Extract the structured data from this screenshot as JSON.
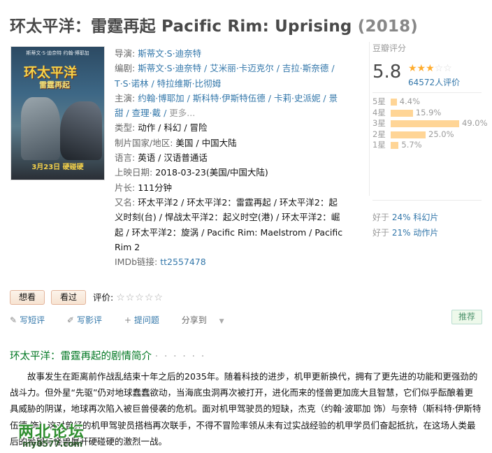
{
  "title": {
    "main": "环太平洋：雷霆再起 Pacific Rim: Uprising",
    "year": "(2018)"
  },
  "poster": {
    "top_text": "斯蒂文·S·迪奈特  约翰·博耶加",
    "title_cn": "环太平洋",
    "subtitle_cn": "雷霆再起",
    "date_text": "3月23日 硬碰硬"
  },
  "info": {
    "director_label": "导演:",
    "director": "斯蒂文·S·迪奈特",
    "writer_label": "编剧:",
    "writer_line1": "斯蒂文·S·迪奈特 / 艾米丽·卡迈克尔 / 吉拉·斯奈德 /",
    "writer_line2": "T·S·诺林 / 特拉维斯·比彻姆",
    "cast_label": "主演:",
    "cast_line1": "约翰·博耶加 / 斯科特·伊斯特伍德 / 卡莉·史派妮 / 景",
    "cast_line2": "甜 / 查理·戴 / ",
    "cast_more": "更多...",
    "genre_label": "类型:",
    "genre": "动作 / 科幻 / 冒险",
    "country_label": "制片国家/地区:",
    "country": "美国 / 中国大陆",
    "language_label": "语言:",
    "language": "英语 / 汉语普通话",
    "release_label": "上映日期:",
    "release": "2018-03-23(美国/中国大陆)",
    "runtime_label": "片长:",
    "runtime": "111分钟",
    "aka_label": "又名:",
    "aka_line1": "环太平洋2 / 环太平洋2：雷霆再起 / 环太平洋2：起",
    "aka_line2": "义时刻(台) / 悍战太平洋2：起义时空(港) / 环太平洋2：崛",
    "aka_line3": "起 / 环太平洋2：旋涡 / Pacific Rim: Maelstrom / Pacific",
    "aka_line4": "Rim 2",
    "imdb_label": "IMDb链接:",
    "imdb": "tt2557478"
  },
  "rating": {
    "header": "豆瓣评分",
    "score": "5.8",
    "stars": "★★★",
    "stars_off": "☆☆",
    "count": "64572人评价",
    "distribution": [
      {
        "label": "5星",
        "pct": "4.4%",
        "value": 4.4
      },
      {
        "label": "4星",
        "pct": "15.9%",
        "value": 15.9
      },
      {
        "label": "3星",
        "pct": "49.0%",
        "value": 49.0
      },
      {
        "label": "2星",
        "pct": "25.0%",
        "value": 25.0
      },
      {
        "label": "1星",
        "pct": "5.7%",
        "value": 5.7
      }
    ],
    "better_than": [
      {
        "prefix": "好于 ",
        "pct": "24%",
        "genre": "科幻片"
      },
      {
        "prefix": "好于 ",
        "pct": "21%",
        "genre": "动作片"
      }
    ]
  },
  "actions": {
    "want": "想看",
    "seen": "看过",
    "eval_label": "评价:",
    "eval_stars": "☆☆☆☆☆",
    "short_review": "写短评",
    "review": "写影评",
    "ask": "提问题",
    "share": "分享到",
    "recommend": "推荐"
  },
  "summary": {
    "heading": "环太平洋：雷霆再起的剧情简介",
    "heading_dots": "· · · · · ·",
    "text": "故事发生在距离前作战乱结束十年之后的2035年。随着科技的进步，机甲更新换代，拥有了更先进的功能和更强劲的战斗力。但外星“先驱”仍对地球蠢蠢欲动，当海底虫洞再次被打开，进化而来的怪兽更加庞大且智慧，它们似乎酝酿着更具威胁的阴谋，地球再次陷入被巨兽侵袭的危机。面对机甲驾驶员的短缺，杰克（约翰·波耶加 饰）与奈特（斯科特·伊斯特伍德 饰）这对曾经的机甲驾驶员搭档再次联手，不得不冒险率领从未有过实战经验的机甲学员们奋起抵抗，在这场人类最后的希望与怪兽展开硬碰硬的激烈一战。"
  },
  "watermark": {
    "text": "两北论坛",
    "url": "my0577.com"
  }
}
